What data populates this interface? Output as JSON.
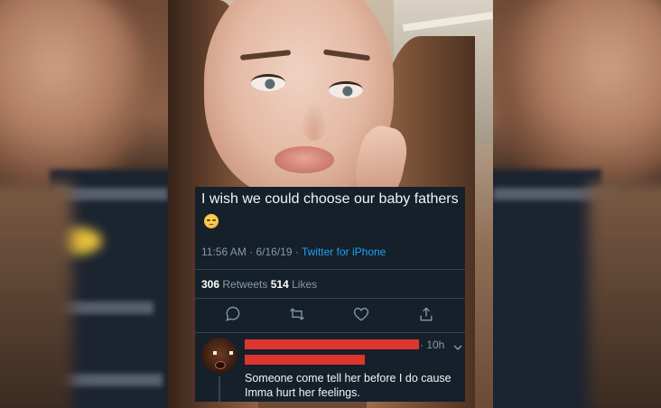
{
  "tweet": {
    "text": "I wish we could choose our baby fathers",
    "emoji": "unamused-face-emoji",
    "time": "11:56 AM · 6/16/19 · ",
    "source": "Twitter for iPhone",
    "retweets_count": "306",
    "retweets_label": " Retweets ",
    "likes_count": "514",
    "likes_label": " Likes"
  },
  "actions": {
    "reply_icon": "reply-icon",
    "retweet_icon": "retweet-icon",
    "like_icon": "heart-icon",
    "share_icon": "share-icon"
  },
  "reply": {
    "time": "· 10h",
    "text": "Someone come tell her before I do cause Imma hurt her feelings.",
    "redaction_color": "#e0342f"
  },
  "colors": {
    "card_bg": "#15202b",
    "link": "#1da1f2",
    "muted": "#8899a6"
  }
}
